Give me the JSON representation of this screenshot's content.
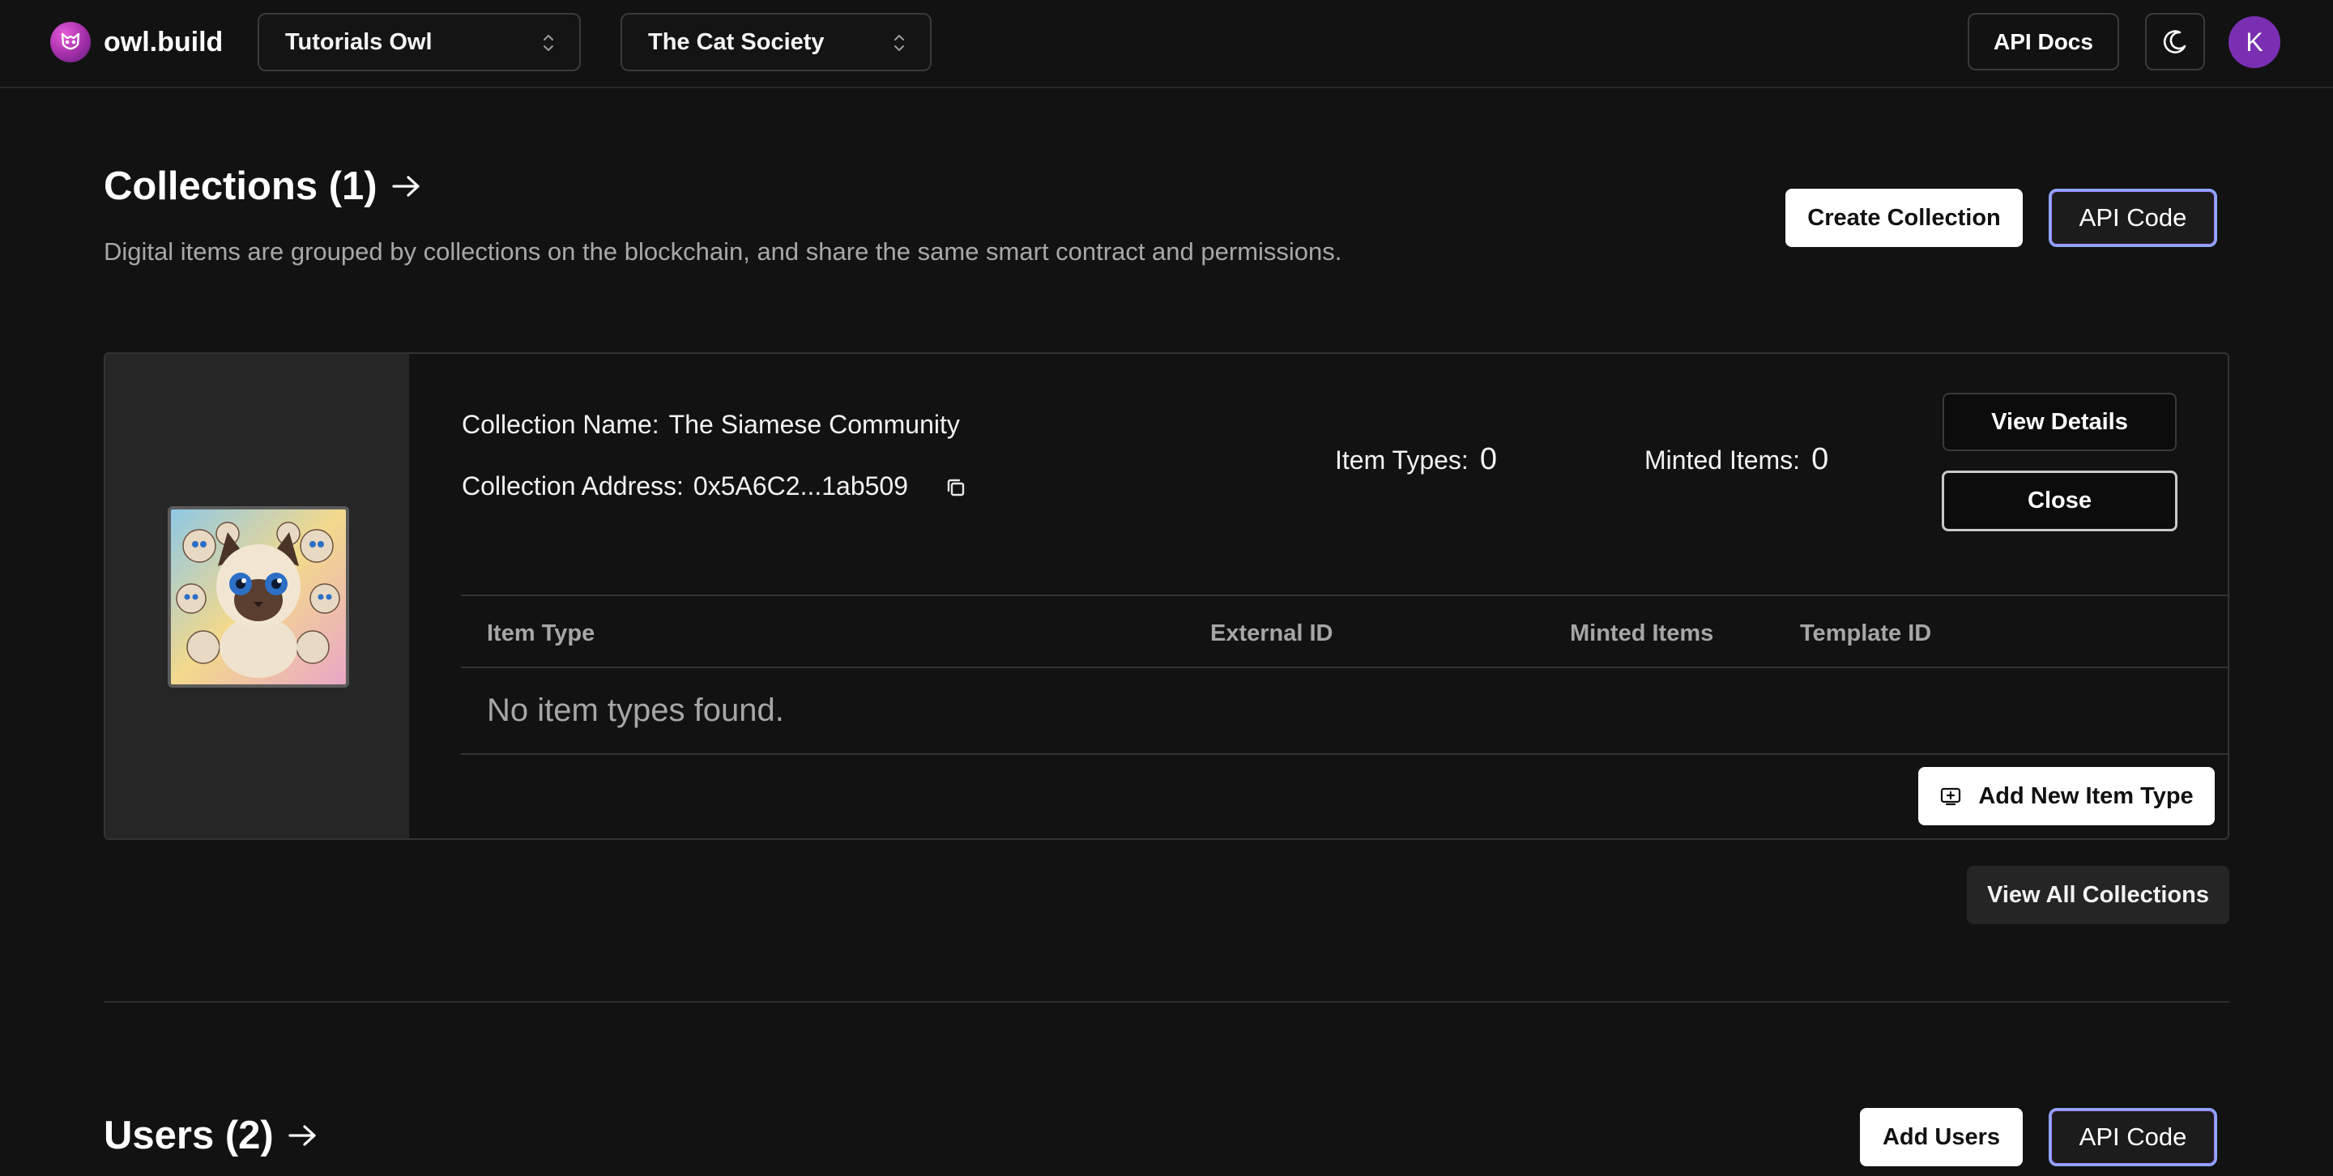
{
  "header": {
    "brand": "owl.build",
    "org_selector": "Tutorials Owl",
    "project_selector": "The Cat Society",
    "api_docs_label": "API Docs",
    "avatar_initial": "K"
  },
  "collections": {
    "title": "Collections (1)",
    "description": "Digital items are grouped by collections on the blockchain, and share the same smart contract and permissions.",
    "create_label": "Create Collection",
    "api_code_label": "API Code",
    "card": {
      "name_label": "Collection Name:",
      "name_value": "The Siamese Community",
      "address_label": "Collection Address:",
      "address_value": "0x5A6C2...1ab509",
      "item_types_label": "Item Types:",
      "item_types_value": "0",
      "minted_label": "Minted Items:",
      "minted_value": "0",
      "view_details_label": "View Details",
      "close_label": "Close",
      "table_headers": [
        "Item Type",
        "External ID",
        "Minted Items",
        "Template ID"
      ],
      "empty_text": "No item types found.",
      "add_item_label": "Add New Item Type"
    },
    "view_all_label": "View All Collections"
  },
  "users": {
    "title": "Users (2)",
    "add_label": "Add Users",
    "api_code_label": "API Code"
  },
  "colors": {
    "background": "#121212",
    "accent_border": "#8fa6ff",
    "avatar": "#7a2fb3",
    "logo": "#a22ea8"
  },
  "icons": [
    "owl-logo-icon",
    "chevron-updown-icon",
    "moon-icon",
    "arrow-right-icon",
    "copy-icon",
    "add-item-icon"
  ]
}
